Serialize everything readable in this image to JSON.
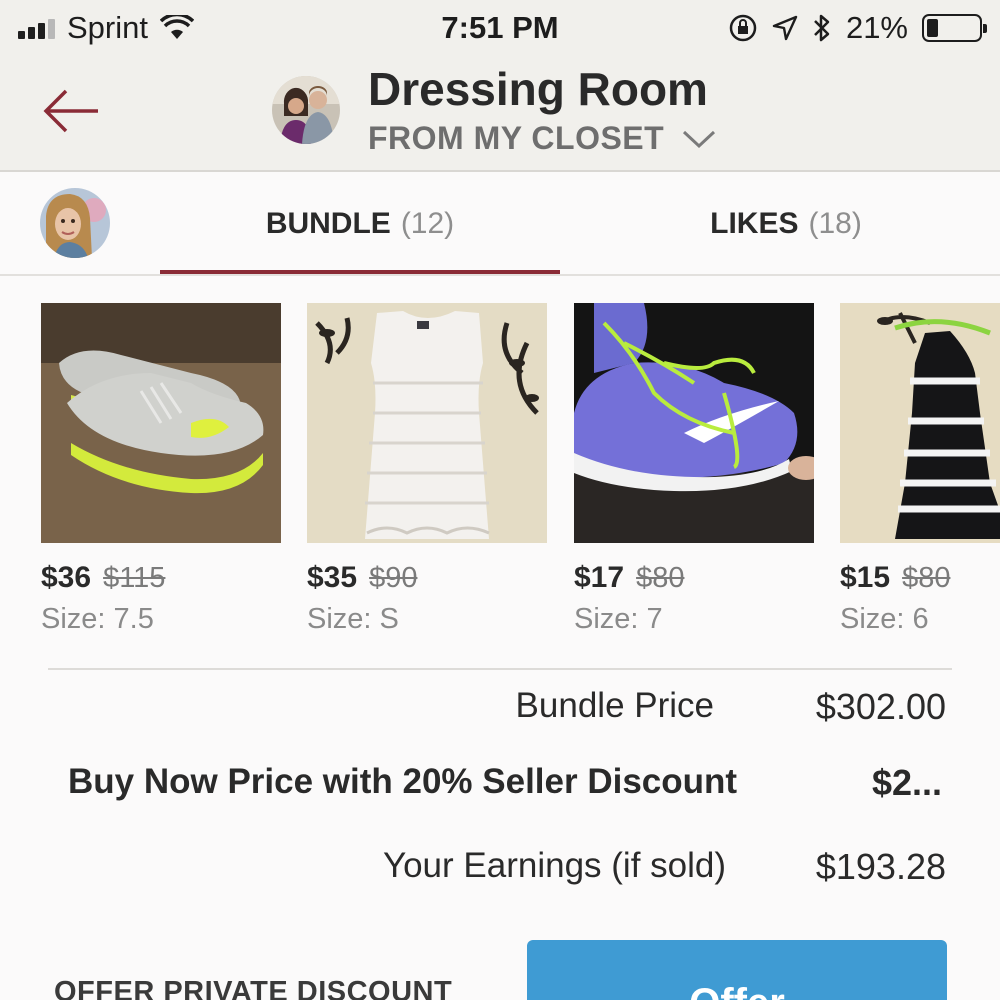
{
  "status_bar": {
    "carrier": "Sprint",
    "time": "7:51 PM",
    "battery_percent": "21%",
    "battery_level": 0.21,
    "icons": [
      "signal-icon",
      "wifi-icon",
      "rotation-lock-icon",
      "location-icon",
      "bluetooth-icon",
      "battery-icon"
    ]
  },
  "header": {
    "title": "Dressing Room",
    "closet_selector": "FROM MY CLOSET",
    "back_icon": "back-arrow-icon",
    "accent_color": "#8a2b36"
  },
  "tabs": [
    {
      "label": "BUNDLE",
      "count": "(12)",
      "active": true
    },
    {
      "label": "LIKES",
      "count": "(18)",
      "active": false
    }
  ],
  "items": [
    {
      "price": "$36",
      "original_price": "$115",
      "size": "Size: 7.5",
      "image": "gray and neon yellow sneakers"
    },
    {
      "price": "$35",
      "original_price": "$90",
      "size": "Size: S",
      "image": "white lace dress"
    },
    {
      "price": "$17",
      "original_price": "$80",
      "size": "Size: 7",
      "image": "purple sneaker with green laces"
    },
    {
      "price": "$15",
      "original_price": "$80",
      "size": "Size: 6",
      "image": "black and white striped dress"
    }
  ],
  "summary": {
    "bundle_price_label": "Bundle Price",
    "bundle_price_value": "$302.00",
    "buy_now_label": "Buy Now Price with 20% Seller Discount",
    "buy_now_value": "$2...",
    "earnings_label": "Your Earnings (if sold)",
    "earnings_value": "$193.28"
  },
  "actions": {
    "offer_private_discount": "OFFER PRIVATE DISCOUNT",
    "offer_button": "Offer",
    "offer_color": "#3f9bd3"
  }
}
